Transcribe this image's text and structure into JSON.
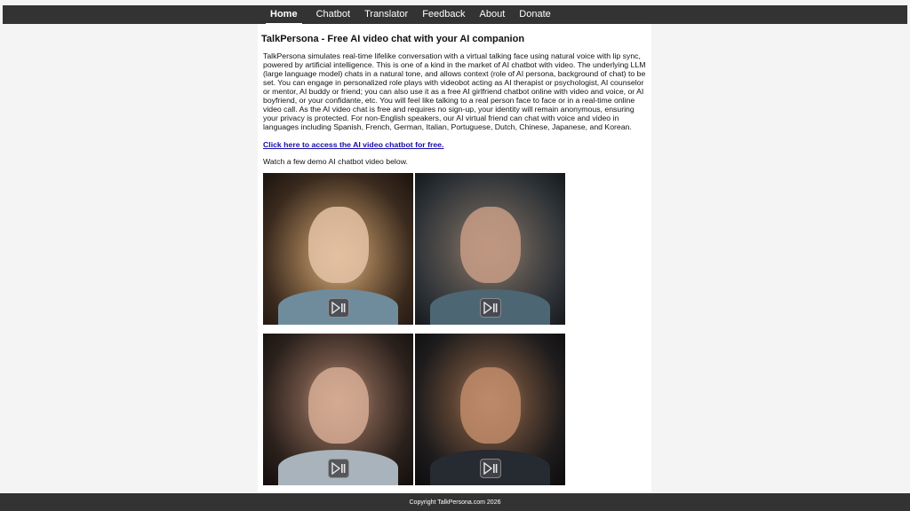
{
  "nav": {
    "items": [
      {
        "label": "Home",
        "active": true
      },
      {
        "label": "Chatbot",
        "active": false
      },
      {
        "label": "Translator",
        "active": false
      },
      {
        "label": "Feedback",
        "active": false
      },
      {
        "label": "About",
        "active": false
      },
      {
        "label": "Donate",
        "active": false
      }
    ],
    "background": "#333333"
  },
  "main": {
    "title": "TalkPersona - Free AI video chat with your AI companion",
    "intro": "TalkPersona simulates real-time lifelike conversation with a virtual talking face using natural voice with lip sync, powered by artificial intelligence. This is one of a kind in the market of AI chatbot with video. The underlying LLM (large language model) chats in a natural tone, and allows context (role of AI persona, background of chat) to be set. You can engage in personalized role plays with videobot acting as AI therapist or psychologist, AI counselor or mentor, AI buddy or friend; you can also use it as a free AI girlfriend chatbot online with video and voice, or AI boyfriend, or your confidante, etc. You will feel like talking to a real person face to face or in a real-time online video call. As the AI video chat is free and requires no sign-up, your identity will remain anonymous, ensuring your privacy is protected. For non-English speakers, our AI virtual friend can chat with voice and video in languages including Spanish, French, German, Italian, Portuguese, Dutch, Chinese, Japanese, and Korean.",
    "cta_link": "Click here to access the AI video chatbot for free.",
    "demo_note": "Watch a few demo AI chatbot video below.",
    "videos": [
      {
        "icon": "play-pause-icon"
      },
      {
        "icon": "play-pause-icon"
      },
      {
        "icon": "play-pause-icon"
      },
      {
        "icon": "play-pause-icon"
      }
    ],
    "link_color": "#1a0dab"
  },
  "footer": {
    "copyright": "Copyright TalkPersona.com 2026"
  }
}
